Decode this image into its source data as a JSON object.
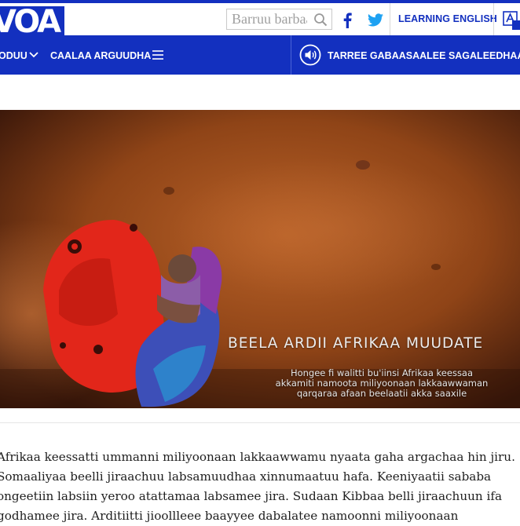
{
  "header": {
    "logo": "VOA",
    "search_placeholder": "Barruu barbaadi",
    "learning_english": "LEARNING ENGLISH"
  },
  "nav": {
    "item1": "ODUU",
    "item2": "CAALAA ARGUUDHA",
    "live_label": "TARREE GABAASAALEE SAGALEEDHAAN"
  },
  "hero": {
    "title": "BEELA ARDII AFRIKAA MUUDATE",
    "subtitle_lines": [
      "Hongee fi walitti bu'iinsi Afrikaa keessaa",
      "akkamiti namoota miliyoonaan lakkaawwaman",
      "qarqaraa afaan beelaatii akka saaxile"
    ]
  },
  "article": {
    "lines": [
      "Afrikaa keessatti ummanni miliyoonaan lakkaawwamu nyaata gaha argachaa hin jiru.",
      "Somaaliyaa beelli jiraachuu labsamuudhaa xinnumaatuu hafa. Keeniyaatii sababa",
      "ongeetiin labsiin yeroo atattamaa labsamee jira. Sudaan Kibbaa belli jiraachuun ifa",
      "godhamee jira. Arditiitti jioollleee baayyee dabalatee namoonni miliyoonaan"
    ]
  },
  "colors": {
    "brand_blue": "#1330bf",
    "twitter_blue": "#1da1f2",
    "hero_ground": "#a24f20"
  }
}
